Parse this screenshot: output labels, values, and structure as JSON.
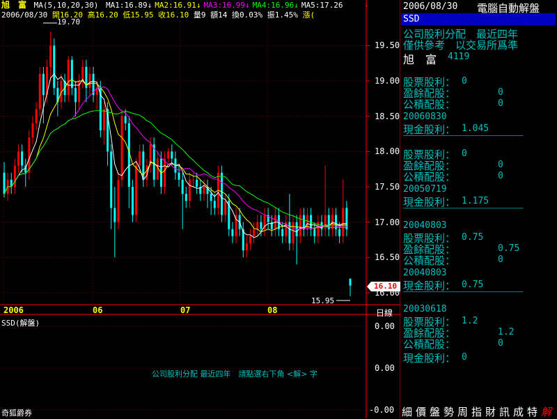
{
  "header": {
    "stock_name": "旭　富",
    "ma_spec": "MA(5,10,20,30)",
    "ma_items": [
      {
        "label": "MA1:16.89",
        "color": "#ffffff"
      },
      {
        "label": "MA2:16.91",
        "color": "#ffff00"
      },
      {
        "label": "MA3:16.99",
        "color": "#ff00ff"
      },
      {
        "label": "MA4:16.96",
        "color": "#00ff00"
      },
      {
        "label": "MA5:17.26",
        "color": "#ffffff"
      }
    ],
    "date": "2006/08/30",
    "open": "開16.20",
    "high": "高16.20",
    "low": "低15.95",
    "close": "收16.10",
    "volume": "量9",
    "amount": "額14",
    "turnover": "換0.03%",
    "amplitude": "振1.45%",
    "change": "漲("
  },
  "chart": {
    "high_label": "19.70",
    "low_label": "15.95",
    "last_price_tag": "16.10",
    "price_axis": [
      "19.50",
      "19.00",
      "18.50",
      "18.00",
      "17.50",
      "17.00",
      "16.50",
      "16.00"
    ],
    "x_labels": [
      "2006",
      "06",
      "07",
      "08"
    ],
    "period_label": "日線",
    "colors": {
      "up": "#ff0000",
      "down": "#00ffff",
      "ma1": "#ffffff",
      "ma2": "#ffff00",
      "ma3": "#ff00ff",
      "ma4": "#00ff00",
      "grid": "#800000",
      "axis": "#ff0000"
    }
  },
  "sub_chart": {
    "title": "SSD(解盤)",
    "axis": [
      "0.00",
      "0.00",
      "-0.00"
    ],
    "message": "公司股利分配 最近四年　請點選右下角 <解> 字"
  },
  "broker": "奇狐爵券",
  "chart_data": {
    "type": "candlestick",
    "title": "",
    "xlabel": "",
    "ylabel": "",
    "ylim": [
      15.85,
      19.85
    ],
    "x_ticks": [
      "2006",
      "06",
      "07",
      "08"
    ],
    "candles": [
      [
        17.7,
        17.4,
        17.85,
        17.35
      ],
      [
        17.4,
        17.6,
        17.7,
        17.3
      ],
      [
        17.6,
        17.5,
        17.7,
        17.4
      ],
      [
        17.5,
        17.8,
        17.9,
        17.4
      ],
      [
        17.8,
        18.0,
        18.1,
        17.7
      ],
      [
        18.0,
        17.8,
        18.1,
        17.7
      ],
      [
        17.8,
        17.7,
        17.9,
        17.5
      ],
      [
        17.7,
        18.2,
        18.3,
        17.6
      ],
      [
        18.2,
        18.4,
        18.5,
        18.1
      ],
      [
        18.4,
        18.6,
        18.7,
        18.3
      ],
      [
        18.6,
        19.1,
        19.2,
        18.5
      ],
      [
        19.1,
        18.8,
        19.2,
        18.4
      ],
      [
        18.8,
        19.2,
        19.3,
        18.7
      ],
      [
        19.2,
        19.5,
        19.7,
        19.0
      ],
      [
        19.5,
        18.9,
        19.6,
        18.8
      ],
      [
        18.9,
        18.7,
        19.0,
        18.5
      ],
      [
        18.7,
        19.0,
        19.1,
        18.6
      ],
      [
        19.0,
        18.8,
        19.1,
        18.7
      ],
      [
        18.8,
        19.3,
        19.35,
        18.7
      ],
      [
        19.3,
        18.9,
        19.35,
        18.8
      ],
      [
        18.9,
        18.7,
        19.0,
        18.5
      ],
      [
        18.7,
        19.0,
        19.1,
        18.6
      ],
      [
        19.0,
        19.2,
        19.3,
        18.9
      ],
      [
        19.2,
        18.9,
        19.3,
        18.7
      ],
      [
        18.9,
        19.1,
        19.2,
        18.8
      ],
      [
        19.1,
        18.8,
        19.2,
        18.7
      ],
      [
        18.8,
        18.9,
        19.0,
        18.6
      ],
      [
        18.9,
        18.3,
        19.0,
        18.2
      ],
      [
        18.3,
        18.6,
        18.7,
        18.1
      ],
      [
        18.6,
        18.0,
        18.7,
        17.8
      ],
      [
        18.0,
        17.2,
        18.1,
        16.9
      ],
      [
        17.2,
        17.0,
        17.5,
        16.5
      ],
      [
        17.0,
        17.6,
        17.7,
        16.9
      ],
      [
        17.6,
        18.5,
        18.6,
        17.5
      ],
      [
        18.5,
        18.4,
        18.6,
        18.3
      ],
      [
        18.4,
        17.5,
        18.5,
        17.2
      ],
      [
        17.5,
        17.1,
        17.6,
        17.0
      ],
      [
        17.1,
        17.8,
        17.9,
        17.0
      ],
      [
        17.8,
        18.0,
        18.1,
        17.7
      ],
      [
        18.0,
        17.6,
        18.1,
        17.5
      ],
      [
        17.6,
        17.8,
        17.9,
        17.5
      ],
      [
        17.8,
        18.1,
        18.2,
        17.7
      ],
      [
        18.1,
        17.6,
        18.2,
        17.5
      ],
      [
        17.6,
        17.9,
        18.0,
        17.6
      ],
      [
        17.9,
        17.5,
        18.0,
        17.4
      ],
      [
        17.5,
        17.9,
        18.0,
        17.4
      ],
      [
        17.9,
        18.0,
        18.05,
        17.85
      ],
      [
        18.0,
        17.9,
        18.1,
        17.8
      ],
      [
        17.9,
        17.7,
        18.0,
        17.6
      ],
      [
        17.7,
        17.6,
        17.8,
        17.5
      ],
      [
        17.6,
        17.4,
        17.7,
        16.9
      ],
      [
        17.4,
        17.3,
        17.5,
        17.2
      ],
      [
        17.3,
        17.6,
        17.7,
        17.2
      ],
      [
        17.6,
        17.6,
        17.7,
        17.5
      ],
      [
        17.6,
        17.5,
        17.7,
        17.4
      ],
      [
        17.5,
        17.4,
        17.6,
        17.3
      ],
      [
        17.4,
        17.5,
        17.6,
        17.3
      ],
      [
        17.5,
        17.4,
        17.6,
        17.2
      ],
      [
        17.4,
        17.3,
        17.5,
        17.1
      ],
      [
        17.3,
        17.2,
        17.4,
        17.1
      ],
      [
        17.2,
        17.7,
        17.8,
        17.1
      ],
      [
        17.7,
        17.1,
        17.8,
        17.0
      ],
      [
        17.1,
        17.3,
        17.4,
        17.0
      ],
      [
        17.3,
        16.9,
        17.4,
        16.8
      ],
      [
        16.9,
        16.8,
        17.0,
        16.7
      ],
      [
        16.8,
        17.1,
        17.2,
        16.7
      ],
      [
        17.1,
        16.9,
        17.2,
        16.8
      ],
      [
        16.9,
        16.6,
        17.0,
        16.5
      ],
      [
        16.6,
        16.7,
        16.8,
        16.5
      ],
      [
        16.7,
        16.8,
        16.9,
        16.6
      ],
      [
        16.8,
        16.9,
        17.0,
        16.7
      ],
      [
        16.9,
        17.0,
        17.1,
        16.8
      ],
      [
        17.0,
        16.9,
        17.1,
        16.8
      ],
      [
        16.9,
        17.1,
        17.2,
        16.8
      ],
      [
        17.1,
        17.0,
        17.2,
        16.9
      ],
      [
        17.0,
        16.9,
        17.1,
        16.8
      ],
      [
        16.9,
        17.1,
        17.2,
        16.8
      ],
      [
        17.1,
        16.9,
        17.2,
        16.8
      ],
      [
        16.9,
        16.8,
        17.0,
        16.7
      ],
      [
        16.8,
        17.0,
        17.1,
        16.7
      ],
      [
        17.0,
        16.7,
        17.4,
        16.6
      ],
      [
        16.7,
        17.0,
        17.1,
        16.6
      ],
      [
        17.0,
        16.8,
        17.1,
        16.4
      ],
      [
        16.8,
        17.1,
        17.2,
        16.7
      ],
      [
        17.1,
        16.9,
        17.2,
        16.8
      ],
      [
        16.9,
        17.1,
        17.2,
        16.8
      ],
      [
        17.1,
        16.9,
        17.2,
        16.8
      ],
      [
        16.9,
        16.8,
        17.0,
        16.7
      ],
      [
        16.8,
        17.0,
        17.1,
        16.7
      ],
      [
        17.0,
        16.9,
        17.1,
        16.8
      ],
      [
        16.9,
        17.1,
        17.8,
        16.8
      ],
      [
        17.1,
        16.9,
        17.2,
        16.8
      ],
      [
        16.9,
        17.1,
        17.2,
        16.8
      ],
      [
        17.1,
        16.9,
        17.2,
        16.8
      ],
      [
        16.9,
        16.8,
        17.0,
        16.7
      ],
      [
        16.8,
        17.2,
        17.6,
        16.7
      ],
      [
        17.2,
        16.9,
        17.3,
        16.8
      ],
      [
        16.2,
        16.1,
        16.2,
        15.95
      ]
    ]
  },
  "right_panel": {
    "date": "2006/08/30",
    "title": "電腦自動解盤",
    "tag": "SSD",
    "line1": "公司股利分配　最近四年",
    "line2": "僅供參考　以交易所爲準",
    "stock": "旭　富",
    "code": "4119",
    "groups": [
      {
        "date": "",
        "rows": [
          {
            "label": "股票股利：",
            "value": "0",
            "col": 1
          },
          {
            "label": "盈餘配股：",
            "value": "0",
            "col": 2
          },
          {
            "label": "公積配股：",
            "value": "0",
            "col": 2
          }
        ]
      },
      {
        "date": "20060830",
        "rows": [
          {
            "label": "現金股利：",
            "value": "1.045",
            "col": 1
          }
        ]
      },
      {
        "date": "",
        "rows": [
          {
            "label": "股票股利：",
            "value": "0",
            "col": 1
          },
          {
            "label": "盈餘配股：",
            "value": "0",
            "col": 2
          },
          {
            "label": "公積配股：",
            "value": "0",
            "col": 2
          }
        ]
      },
      {
        "date": "20050719",
        "rows": [
          {
            "label": "現金股利：",
            "value": "1.175",
            "col": 1
          }
        ]
      },
      {
        "date": "20040803",
        "rows": [
          {
            "label": "股票股利：",
            "value": "0.75",
            "col": 1
          },
          {
            "label": "盈餘配股：",
            "value": "0.75",
            "col": 2
          },
          {
            "label": "公積配股：",
            "value": "0",
            "col": 2
          }
        ]
      },
      {
        "date": "20040803",
        "rows": [
          {
            "label": "現金股利：",
            "value": "0.75",
            "col": 1
          }
        ]
      },
      {
        "date": "20030618",
        "rows": [
          {
            "label": "股票股利：",
            "value": "1.2",
            "col": 1
          },
          {
            "label": "盈餘配股：",
            "value": "1.2",
            "col": 2
          },
          {
            "label": "公積配股：",
            "value": "0",
            "col": 2
          }
        ]
      },
      {
        "date": "",
        "rows": [
          {
            "label": "現金股利：",
            "value": "0",
            "col": 1
          }
        ]
      }
    ]
  },
  "tabs": [
    {
      "label": "細",
      "active": false
    },
    {
      "label": "價",
      "active": false
    },
    {
      "label": "盤",
      "active": false
    },
    {
      "label": "勢",
      "active": false
    },
    {
      "label": "周",
      "active": false
    },
    {
      "label": "指",
      "active": false
    },
    {
      "label": "財",
      "active": false
    },
    {
      "label": "訊",
      "active": false
    },
    {
      "label": "成",
      "active": false
    },
    {
      "label": "特",
      "active": false
    },
    {
      "label": "解",
      "active": true
    }
  ]
}
